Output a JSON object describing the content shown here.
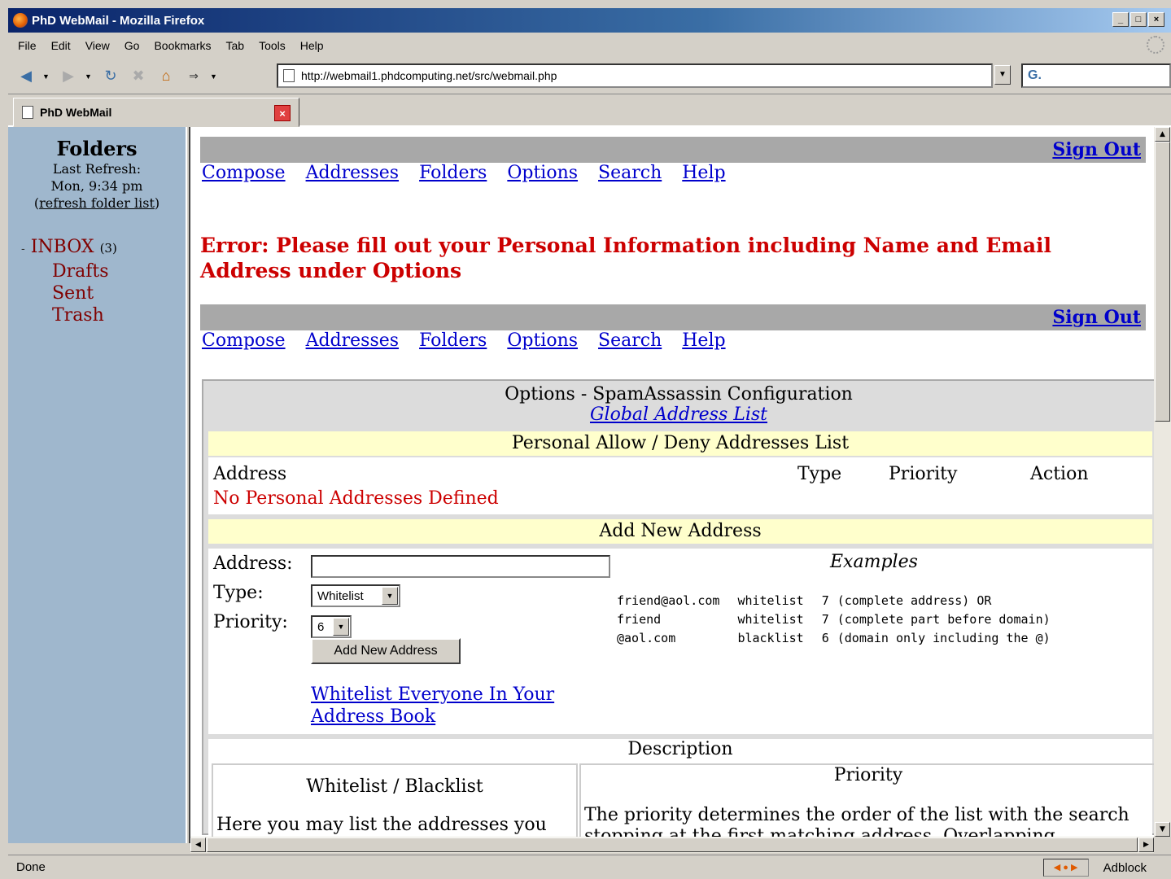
{
  "window": {
    "title": "PhD WebMail - Mozilla Firefox",
    "controls": [
      "_",
      "□",
      "×"
    ]
  },
  "menu": [
    "File",
    "Edit",
    "View",
    "Go",
    "Bookmarks",
    "Tab",
    "Tools",
    "Help"
  ],
  "nav": {
    "url": "http://webmail1.phdcomputing.net/src/webmail.php",
    "search_value": "G."
  },
  "tab": {
    "title": "PhD WebMail",
    "close": "×"
  },
  "sidebar": {
    "title": "Folders",
    "last_refresh_label": "Last Refresh:",
    "last_refresh_time": "Mon, 9:34 pm",
    "refresh_link": "refresh folder list",
    "inbox_label": "INBOX",
    "inbox_count": "(3)",
    "folders": [
      "Drafts",
      "Sent",
      "Trash"
    ]
  },
  "toolbar": {
    "sign_out": "Sign Out",
    "links": [
      "Compose",
      "Addresses",
      "Folders",
      "Options",
      "Search",
      "Help"
    ]
  },
  "error": "Error: Please fill out your Personal Information including Name and Email Address under Options",
  "options": {
    "title": "Options - SpamAssassin Configuration",
    "global_link": "Global Address List",
    "list_header": "Personal Allow / Deny Addresses List",
    "columns": [
      "Address",
      "Type",
      "Priority",
      "Action"
    ],
    "empty_message": "No Personal Addresses Defined",
    "add_header": "Add New Address",
    "address_label": "Address:",
    "address_value": "",
    "type_label": "Type:",
    "type_value": "Whitelist",
    "priority_label": "Priority:",
    "priority_value": "6",
    "add_button": "Add New Address",
    "whitelist_all_link": "Whitelist Everyone In Your Address Book",
    "examples_title": "Examples",
    "examples": [
      {
        "address": "friend@aol.com",
        "type": "whitelist",
        "priority": "7",
        "note": "(complete address) OR"
      },
      {
        "address": "friend",
        "type": "whitelist",
        "priority": "7",
        "note": "(complete part before domain)"
      },
      {
        "address": "@aol.com",
        "type": "blacklist",
        "priority": "6",
        "note": "(domain only including the @)"
      }
    ],
    "description_title": "Description",
    "desc_left_title": "Whitelist / Blacklist",
    "desc_left_text": "Here you may list the addresses you",
    "desc_right_title": "Priority",
    "desc_right_text": "The priority determines the order of the list with the search stopping at the first matching address. Overlapping"
  },
  "status": {
    "text": "Done",
    "adblock": "Adblock"
  }
}
